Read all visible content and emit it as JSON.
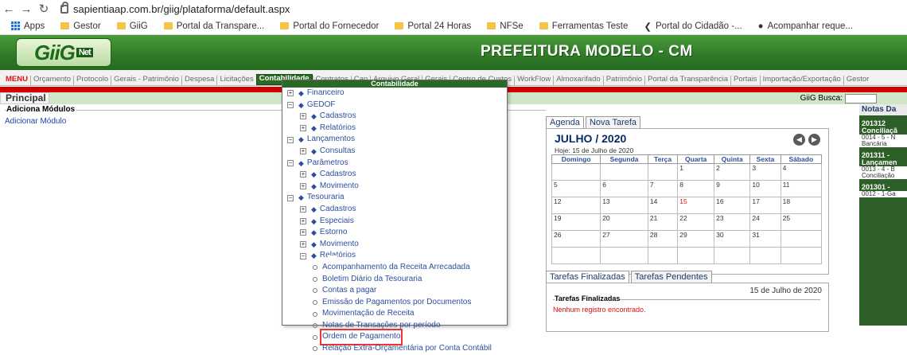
{
  "browser": {
    "url": "sapientiaap.com.br/giig/plataforma/default.aspx",
    "bookmarks": [
      "Apps",
      "Gestor",
      "GiiG",
      "Portal da Transpare...",
      "Portal do Fornecedor",
      "Portal 24 Horas",
      "NFSe",
      "Ferramentas Teste",
      "Portal do Cidadão -...",
      "Acompanhar reque..."
    ]
  },
  "header": {
    "logo": "GiiG",
    "logo_sub": "Net",
    "title": "PREFEITURA MODELO - CM"
  },
  "menu": {
    "items": [
      "MENU",
      "Orçamento",
      "Protocolo",
      "Gerais - Patrimônio",
      "Despesa",
      "Licitações",
      "Contabilidade",
      "Contratos",
      "Cap",
      "Arquivo Geral",
      "Gerais",
      "Centro de Custos",
      "WorkFlow",
      "Almoxarifado",
      "Patrimônio",
      "Portal da Transparência",
      "Portais",
      "Importação/Exportação",
      "Gestor"
    ],
    "active": "Contabilidade"
  },
  "search": {
    "label": "GiiG Busca:"
  },
  "principal": "Principal",
  "modules": {
    "title": "Adiciona Módulos",
    "add_link": "Adicionar Módulo"
  },
  "dropdown": {
    "header": "Contabilidade",
    "rows": [
      {
        "level": 0,
        "kind": "pm",
        "sign": "+",
        "label": "Financeiro"
      },
      {
        "level": 0,
        "kind": "pm",
        "sign": "−",
        "label": "GEDOF"
      },
      {
        "level": 1,
        "kind": "pm",
        "sign": "+",
        "label": "Cadastros"
      },
      {
        "level": 1,
        "kind": "pm",
        "sign": "+",
        "label": "Relatórios"
      },
      {
        "level": 0,
        "kind": "pm",
        "sign": "−",
        "label": "Lançamentos"
      },
      {
        "level": 1,
        "kind": "pm",
        "sign": "+",
        "label": "Consultas"
      },
      {
        "level": 0,
        "kind": "pm",
        "sign": "−",
        "label": "Parâmetros"
      },
      {
        "level": 1,
        "kind": "pm",
        "sign": "+",
        "label": "Cadastros"
      },
      {
        "level": 1,
        "kind": "pm",
        "sign": "+",
        "label": "Movimento"
      },
      {
        "level": 0,
        "kind": "pm",
        "sign": "−",
        "label": "Tesouraria"
      },
      {
        "level": 1,
        "kind": "pm",
        "sign": "+",
        "label": "Cadastros"
      },
      {
        "level": 1,
        "kind": "pm",
        "sign": "+",
        "label": "Especiais"
      },
      {
        "level": 1,
        "kind": "pm",
        "sign": "+",
        "label": "Estorno"
      },
      {
        "level": 1,
        "kind": "pm",
        "sign": "+",
        "label": "Movimento"
      },
      {
        "level": 1,
        "kind": "pm",
        "sign": "−",
        "label": "Relatórios"
      },
      {
        "level": 2,
        "kind": "leaf",
        "label": "Acompanhamento da Receita Arrecadada"
      },
      {
        "level": 2,
        "kind": "leaf",
        "label": "Boletim Diário da Tesouraria"
      },
      {
        "level": 2,
        "kind": "leaf",
        "label": "Contas a pagar"
      },
      {
        "level": 2,
        "kind": "leaf",
        "label": "Emissão de Pagamentos por Documentos"
      },
      {
        "level": 2,
        "kind": "leaf",
        "label": "Movimentação de Receita"
      },
      {
        "level": 2,
        "kind": "leaf",
        "label": "Notas de Transações por período"
      },
      {
        "level": 2,
        "kind": "leaf",
        "label": "Ordem de Pagamento",
        "highlight": true
      },
      {
        "level": 2,
        "kind": "leaf",
        "label": "Relação Extra-Orçamentária por Conta Contábil"
      }
    ]
  },
  "agenda": {
    "tabs": [
      "Agenda",
      "Nova Tarefa"
    ],
    "month_title": "JULHO / 2020",
    "today_text": "Hoje: 15 de Julho de 2020",
    "weekdays": [
      "Domingo",
      "Segunda",
      "Terça",
      "Quarta",
      "Quinta",
      "Sexta",
      "Sábado"
    ],
    "weeks": [
      [
        "",
        "",
        "",
        "1",
        "2",
        "3",
        "4"
      ],
      [
        "5",
        "6",
        "7",
        "8",
        "9",
        "10",
        "11"
      ],
      [
        "12",
        "13",
        "14",
        "15",
        "16",
        "17",
        "18"
      ],
      [
        "19",
        "20",
        "21",
        "22",
        "23",
        "24",
        "25"
      ],
      [
        "26",
        "27",
        "28",
        "29",
        "30",
        "31",
        ""
      ],
      [
        "",
        "",
        "",
        "",
        "",
        "",
        ""
      ]
    ],
    "today": "15"
  },
  "tasks": {
    "tabs": [
      "Tarefas Finalizadas",
      "Tarefas Pendentes"
    ],
    "date": "15 de Julho de 2020",
    "fieldset": "Tarefas Finalizadas",
    "message": "Nenhum registro encontrado."
  },
  "notes": {
    "header": "Notas Da",
    "groups": [
      {
        "title": "201312 Conciliaçã",
        "items": [
          "0014 - 5 - N",
          "Bancária"
        ]
      },
      {
        "title": "201311 - Lançamen",
        "items": [
          "0013 - 4 - B",
          "Conciliação"
        ]
      },
      {
        "title": "201301 -",
        "items": [
          "0012 - 1-Ga"
        ]
      }
    ]
  }
}
